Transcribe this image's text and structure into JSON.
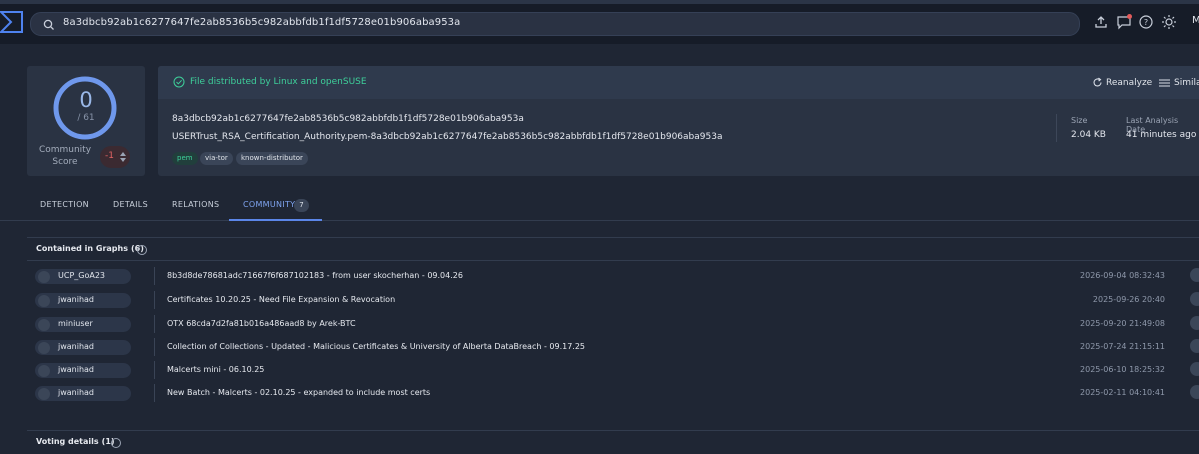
{
  "search": {
    "value": "8a3dbcb92ab1c6277647fe2ab8536b5c982abbfdb1f1df5728e01b906aba953a"
  },
  "toolbar": {
    "icons": [
      "upload-icon",
      "chat-icon",
      "help-icon",
      "theme-icon"
    ],
    "account_initial": "M"
  },
  "score": {
    "detections": "0",
    "total": "/ 61",
    "community_label": "Community Score",
    "community_value": "-1"
  },
  "file": {
    "distributed_by": "File distributed by Linux and openSUSE",
    "reanalyze": "Reanalyze",
    "similar": "Similar",
    "hash": "8a3dbcb92ab1c6277647fe2ab8536b5c982abbfdb1f1df5728e01b906aba953a",
    "name": "USERTrust_RSA_Certification_Authority.pem-8a3dbcb92ab1c6277647fe2ab8536b5c982abbfdb1f1df5728e01b906aba953a",
    "tags": [
      "pem",
      "via-tor",
      "known-distributor"
    ],
    "size_label": "Size",
    "size_value": "2.04 KB",
    "last_analysis_label": "Last Analysis Date",
    "last_analysis_value": "41 minutes ago"
  },
  "tabs": [
    {
      "label": "DETECTION"
    },
    {
      "label": "DETAILS"
    },
    {
      "label": "RELATIONS"
    },
    {
      "label": "COMMUNITY",
      "badge": "7"
    }
  ],
  "graphs": {
    "title": "Contained in Graphs",
    "count": "(6)",
    "rows": [
      {
        "user": "UCP_GoA23",
        "name": "8b3d8de78681adc71667f6f687102183 - from user skocherhan - 09.04.26",
        "date": "2026-09-04 08:32:43"
      },
      {
        "user": "jwanihad",
        "name": "Certificates 10.20.25 - Need File Expansion & Revocation",
        "date": "2025-09-26 20:40"
      },
      {
        "user": "miniuser",
        "name": "OTX 68cda7d2fa81b016a486aad8 by Arek-BTC",
        "date": "2025-09-20 21:49:08"
      },
      {
        "user": "jwanihad",
        "name": "Collection of Collections - Updated - Malicious Certificates & University of Alberta DataBreach - 09.17.25",
        "date": "2025-07-24 21:15:11"
      },
      {
        "user": "jwanihad",
        "name": "Malcerts mini - 06.10.25",
        "date": "2025-06-10 18:25:32"
      },
      {
        "user": "jwanihad",
        "name": "New Batch - Malcerts - 02.10.25 - expanded to include most certs",
        "date": "2025-02-11 04:10:41"
      }
    ]
  },
  "voting": {
    "title": "Voting details",
    "count": "(1)"
  },
  "colors": {
    "accent": "#5b86e8",
    "success": "#3ecf9a",
    "danger": "#e36464"
  }
}
